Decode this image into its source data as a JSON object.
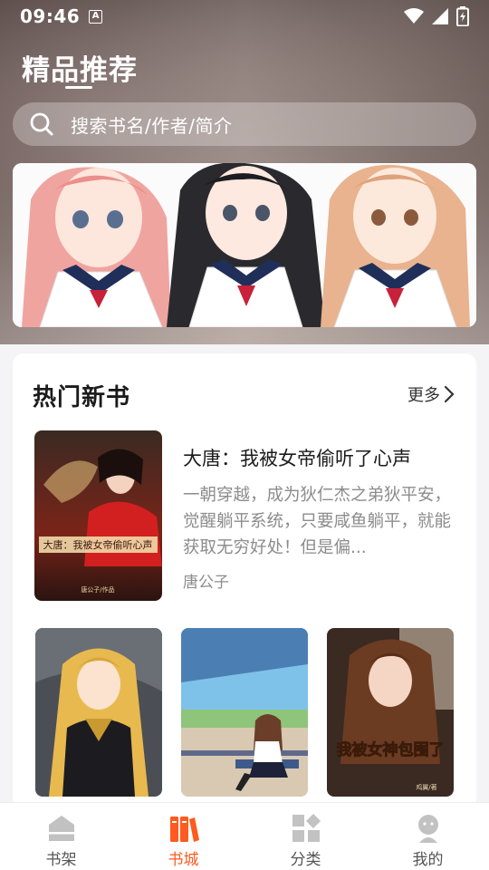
{
  "status_bar": {
    "time": "09:46",
    "a_icon_label": "A"
  },
  "header": {
    "title": "精品推荐",
    "search_placeholder": "搜索书名/作者/简介"
  },
  "banner": {
    "image": "three-anime-girls-sailor-uniform"
  },
  "hot_books": {
    "title": "热门新书",
    "more_label": "更多",
    "featured": {
      "title": "大唐：我被女帝偷听了心声",
      "description": "一朝穿越，成为狄仁杰之弟狄平安，觉醒躺平系统，只要咸鱼躺平，就能获取无穷好处！但是偏...",
      "author": "唐公子",
      "cover_text": "大唐：我被女帝偷听心声",
      "cover_subtext": "唐公子/作品"
    },
    "grid": [
      {
        "cover": "blonde-girl-dark-dress"
      },
      {
        "cover": "girl-on-train-platform"
      },
      {
        "cover": "我被女神包围了",
        "cover_author": "鸡翼/著"
      }
    ]
  },
  "bottom_nav": {
    "items": [
      {
        "label": "书架",
        "icon": "bookshelf-icon",
        "active": false
      },
      {
        "label": "书城",
        "icon": "bookstore-icon",
        "active": true
      },
      {
        "label": "分类",
        "icon": "category-icon",
        "active": false
      },
      {
        "label": "我的",
        "icon": "profile-icon",
        "active": false
      }
    ],
    "active_color": "#ff5a1f",
    "inactive_color": "#bcbcbc"
  }
}
